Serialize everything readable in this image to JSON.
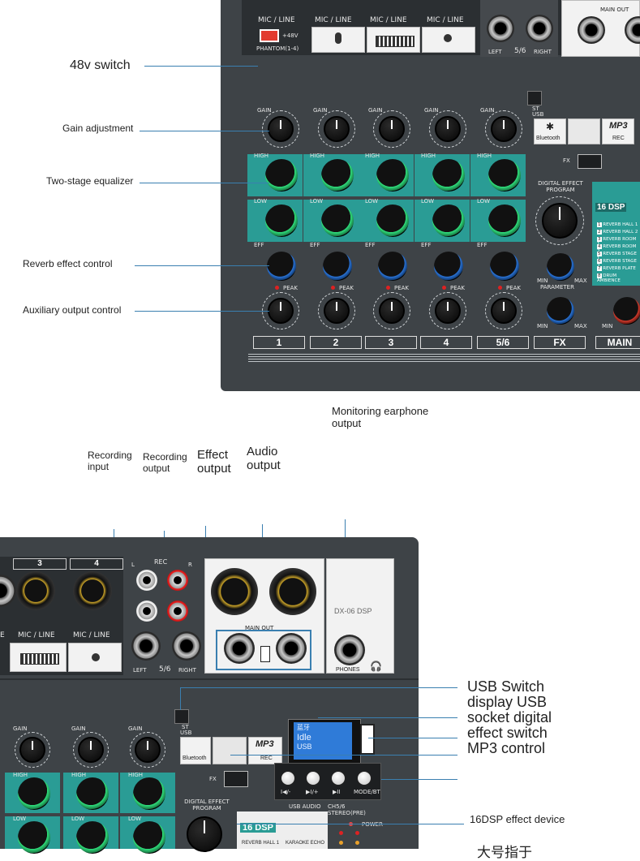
{
  "top_panel": {
    "mic_line_labels": [
      "MIC / LINE",
      "MIC / LINE",
      "MIC / LINE",
      "MIC / LINE"
    ],
    "phantom_label": "+48V",
    "phantom_caption": "PHANTOM(1-4)",
    "stereo_left": "LEFT",
    "stereo_num": "5/6",
    "stereo_right": "RIGHT",
    "main_out": "MAIN OUT",
    "gain_labels": [
      "GAIN",
      "GAIN",
      "GAIN",
      "GAIN",
      "GAIN"
    ],
    "high_labels": [
      "HIGH",
      "HIGH",
      "HIGH",
      "HIGH",
      "HIGH"
    ],
    "low_labels": [
      "LOW",
      "LOW",
      "LOW",
      "LOW",
      "LOW"
    ],
    "eff_labels": [
      "EFF",
      "EFF",
      "EFF",
      "EFF",
      "EFF"
    ],
    "peak_label": "PEAK",
    "channel_numbers": [
      "1",
      "2",
      "3",
      "4",
      "5/6"
    ],
    "fx_strip": "FX",
    "main_strip": "MAIN",
    "st_usb": "ST\nUSB",
    "bluetooth": "Bluetooth",
    "mp3": "MP3",
    "rec": "REC",
    "fx_switch": "FX",
    "digital_effect_program": "DIGITAL EFFECT PROGRAM",
    "parameter": "PARAMETER",
    "min": "MIN",
    "max": "MAX",
    "dsp_badge": "16 DSP",
    "effect_list": [
      "REVERB HALL 1",
      "REVERB HALL 2",
      "REVERB ROOM 1",
      "REVERB ROOM 2",
      "REVERB STAGE 1",
      "REVERB STAGE 2",
      "REVERB PLATE",
      "DRUM AMBIENCE"
    ]
  },
  "callouts_top": {
    "switch_48v": "48v switch",
    "gain": "Gain adjustment",
    "eq": "Two-stage equalizer",
    "reverb": "Reverb effect control",
    "aux": "Auxiliary output control"
  },
  "callouts_mid": {
    "monitoring": "Monitoring earphone output",
    "rec_input": "Recording input",
    "rec_output": "Recording output",
    "effect_output": "Effect output",
    "audio_output": "Audio output"
  },
  "bottom_panel": {
    "ch3": "3",
    "ch4": "4",
    "mic_line": [
      "E",
      "MIC / LINE",
      "MIC / LINE"
    ],
    "rec": "REC",
    "L": "L",
    "R": "R",
    "left": "LEFT",
    "num": "5/6",
    "right": "RIGHT",
    "main_out": "MAIN OUT",
    "model": "DX-06 DSP",
    "phones": "PHONES",
    "gain": [
      "GAIN",
      "GAIN",
      "GAIN"
    ],
    "high": [
      "HIGH",
      "HIGH",
      "HIGH"
    ],
    "low": [
      "LOW",
      "LOW",
      "LOW"
    ],
    "st_usb": "ST\nUSB",
    "bluetooth": "Bluetooth",
    "mp3": "MP3",
    "rec2": "REC",
    "fx": "FX",
    "digital_effect_program": "DIGITAL EFFECT PROGRAM",
    "dsp": "16 DSP",
    "usb_audio": "USB AUDIO",
    "ch56": "CH5/6",
    "stereo_pre": "STEREO(PRE)",
    "power": "POWER",
    "lcd_lines": [
      "蓝牙",
      "Idle",
      "USB"
    ],
    "mp3_buttons": [
      "I◀/-",
      "▶I/+",
      "▶II",
      "MODE/BT"
    ],
    "effect_items": [
      "REVERB HALL 1",
      "KARAOKE ECHO"
    ]
  },
  "callouts_bottom": {
    "usb_switch": "USB Switch",
    "display_usb": "display USB",
    "socket_digital": "socket digital",
    "effect_switch": "effect switch",
    "mp3_control": "MP3 control",
    "dsp_device": "16DSP effect device",
    "cut_text": "大号指于"
  },
  "colors": {
    "panel": "#3e4347",
    "teal": "#2a9c95",
    "callout_line": "#3a7fb0"
  }
}
